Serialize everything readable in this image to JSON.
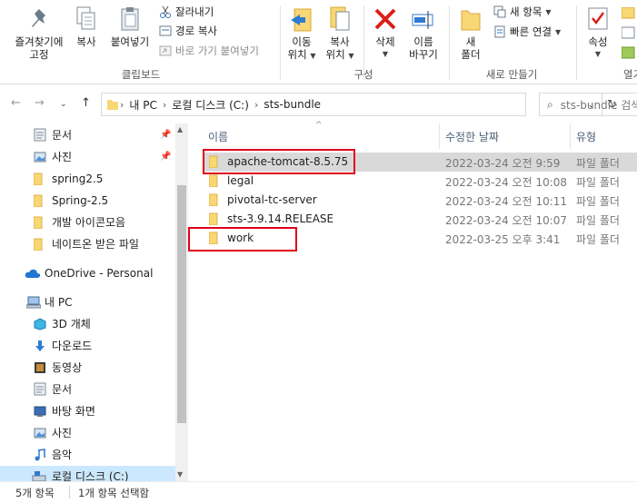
{
  "ribbon": {
    "clipboard": {
      "pin_label_1": "즐겨찾기에",
      "pin_label_2": "고정",
      "copy_label": "복사",
      "paste_label": "붙여넣기",
      "cut_label": "잘라내기",
      "copy_path_label": "경로 복사",
      "paste_shortcut_label": "바로 가기 붙여넣기",
      "group_label": "클립보드"
    },
    "organize": {
      "move_label_1": "이동",
      "move_label_2": "위치",
      "copy_to_label_1": "복사",
      "copy_to_label_2": "위치",
      "delete_label": "삭제",
      "rename_label_1": "이름",
      "rename_label_2": "바꾸기",
      "group_label": "구성"
    },
    "new": {
      "new_folder_label_1": "새",
      "new_folder_label_2": "폴더",
      "new_item_label": "새 항목",
      "easy_access_label": "빠른 연결",
      "group_label": "새로 만들기"
    },
    "open": {
      "properties_label": "속성",
      "group_label_partial": "열기"
    }
  },
  "address": {
    "segments": [
      "내 PC",
      "로컬 디스크 (C:)",
      "sts-bundle"
    ],
    "search_placeholder": "sts-bundle 검색"
  },
  "nav_pane": {
    "quick_access": [
      {
        "label": "문서",
        "icon": "documents-icon",
        "pinned": true
      },
      {
        "label": "사진",
        "icon": "pictures-icon",
        "pinned": true
      },
      {
        "label": "spring2.5",
        "icon": "folder-icon",
        "pinned": false
      },
      {
        "label": "Spring-2.5",
        "icon": "folder-icon",
        "pinned": false
      },
      {
        "label": "개발 아이콘모음",
        "icon": "folder-icon",
        "pinned": false
      },
      {
        "label": "네이트온 받은 파일",
        "icon": "folder-icon",
        "pinned": false
      }
    ],
    "onedrive": "OneDrive - Personal",
    "this_pc": "내 PC",
    "pc_items": [
      {
        "label": "3D 개체",
        "icon": "3d-objects-icon"
      },
      {
        "label": "다운로드",
        "icon": "downloads-icon"
      },
      {
        "label": "동영상",
        "icon": "videos-icon"
      },
      {
        "label": "문서",
        "icon": "documents-icon"
      },
      {
        "label": "바탕 화면",
        "icon": "desktop-icon"
      },
      {
        "label": "사진",
        "icon": "pictures-icon"
      },
      {
        "label": "음악",
        "icon": "music-icon"
      },
      {
        "label": "로컬 디스크 (C:)",
        "icon": "local-disk-icon"
      }
    ]
  },
  "file_list": {
    "columns": {
      "name": "이름",
      "modified": "수정한 날짜",
      "type": "유형"
    },
    "rows": [
      {
        "name": "apache-tomcat-8.5.75",
        "modified": "2022-03-24 오전 9:59",
        "type": "파일 폴더",
        "selected": true,
        "highlighted": true
      },
      {
        "name": "legal",
        "modified": "2022-03-24 오전 10:08",
        "type": "파일 폴더",
        "selected": false,
        "highlighted": false
      },
      {
        "name": "pivotal-tc-server",
        "modified": "2022-03-24 오전 10:11",
        "type": "파일 폴더",
        "selected": false,
        "highlighted": false
      },
      {
        "name": "sts-3.9.14.RELEASE",
        "modified": "2022-03-24 오전 10:07",
        "type": "파일 폴더",
        "selected": false,
        "highlighted": false
      },
      {
        "name": "work",
        "modified": "2022-03-25 오후 3:41",
        "type": "파일 폴더",
        "selected": false,
        "highlighted": true
      }
    ]
  },
  "status": {
    "item_count": "5개 항목",
    "selected_count": "1개 항목 선택함"
  },
  "colors": {
    "folder": "#f8d775",
    "highlight_border": "#e0001a",
    "selected_row": "#d9d9d9",
    "nav_selected": "#cce8ff",
    "delete_red": "#d9201b"
  }
}
